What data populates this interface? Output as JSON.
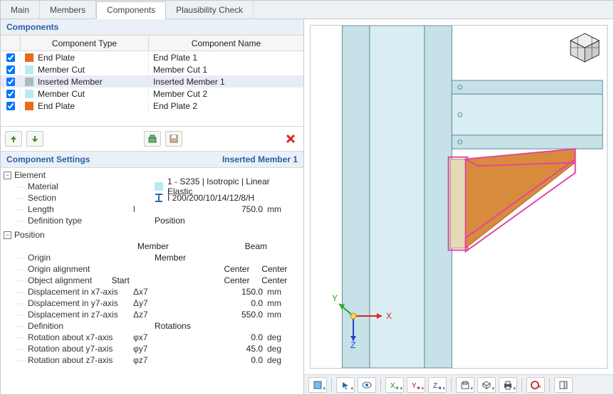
{
  "tabs": [
    "Main",
    "Members",
    "Components",
    "Plausibility Check"
  ],
  "active_tab": 2,
  "components_panel": {
    "title": "Components",
    "headers": {
      "type": "Component Type",
      "name": "Component Name"
    },
    "rows": [
      {
        "checked": true,
        "swatch": "sw-orange",
        "type": "End Plate",
        "name": "End Plate 1",
        "selected": false
      },
      {
        "checked": true,
        "swatch": "sw-cyan",
        "type": "Member Cut",
        "name": "Member Cut 1",
        "selected": false
      },
      {
        "checked": true,
        "swatch": "sw-gray",
        "type": "Inserted Member",
        "name": "Inserted Member 1",
        "selected": true
      },
      {
        "checked": true,
        "swatch": "sw-cyan",
        "type": "Member Cut",
        "name": "Member Cut 2",
        "selected": false
      },
      {
        "checked": true,
        "swatch": "sw-orange",
        "type": "End Plate",
        "name": "End Plate 2",
        "selected": false
      }
    ]
  },
  "settings_panel": {
    "title": "Component Settings",
    "subtitle": "Inserted Member 1",
    "groups": [
      {
        "label": "Element",
        "rows": [
          {
            "label": "Material",
            "sym": "",
            "valicon": "cyan",
            "val": "1 - S235 | Isotropic | Linear Elastic",
            "unit": ""
          },
          {
            "label": "Section",
            "sym": "",
            "valicon": "isec",
            "val": "I 200/200/10/14/12/8/H",
            "unit": ""
          },
          {
            "label": "Length",
            "sym": "l",
            "val": "750.0",
            "unit": "mm",
            "align": "right"
          },
          {
            "label": "Definition type",
            "sym": "",
            "val": "Position",
            "unit": ""
          }
        ]
      },
      {
        "label": "Position",
        "head": {
          "h1": "Member",
          "h2": "Beam"
        },
        "rows": [
          {
            "label": "Origin",
            "sym": "",
            "val": "Member",
            "unit": "",
            "twocol": false
          },
          {
            "label": "Origin alignment",
            "sym": "",
            "val": "",
            "v1": "Center",
            "v2": "Center",
            "twocol": true
          },
          {
            "label": "Object alignment",
            "sym": "",
            "val": "Start",
            "v1": "Center",
            "v2": "Center",
            "twocol": true
          },
          {
            "label": "Displacement in x7-axis",
            "sym": "Δx7",
            "val": "150.0",
            "unit": "mm",
            "align": "right"
          },
          {
            "label": "Displacement in y7-axis",
            "sym": "Δy7",
            "val": "0.0",
            "unit": "mm",
            "align": "right"
          },
          {
            "label": "Displacement in z7-axis",
            "sym": "Δz7",
            "val": "550.0",
            "unit": "mm",
            "align": "right"
          },
          {
            "label": "Definition",
            "sym": "",
            "val": "Rotations",
            "unit": ""
          },
          {
            "label": "Rotation about x7-axis",
            "sym": "φx7",
            "val": "0.0",
            "unit": "deg",
            "align": "right"
          },
          {
            "label": "Rotation about y7-axis",
            "sym": "φy7",
            "val": "45.0",
            "unit": "deg",
            "align": "right"
          },
          {
            "label": "Rotation about z7-axis",
            "sym": "φz7",
            "val": "0.0",
            "unit": "deg",
            "align": "right"
          }
        ]
      }
    ]
  },
  "axis_labels": {
    "x": "X",
    "y": "Y",
    "z": "Z"
  }
}
